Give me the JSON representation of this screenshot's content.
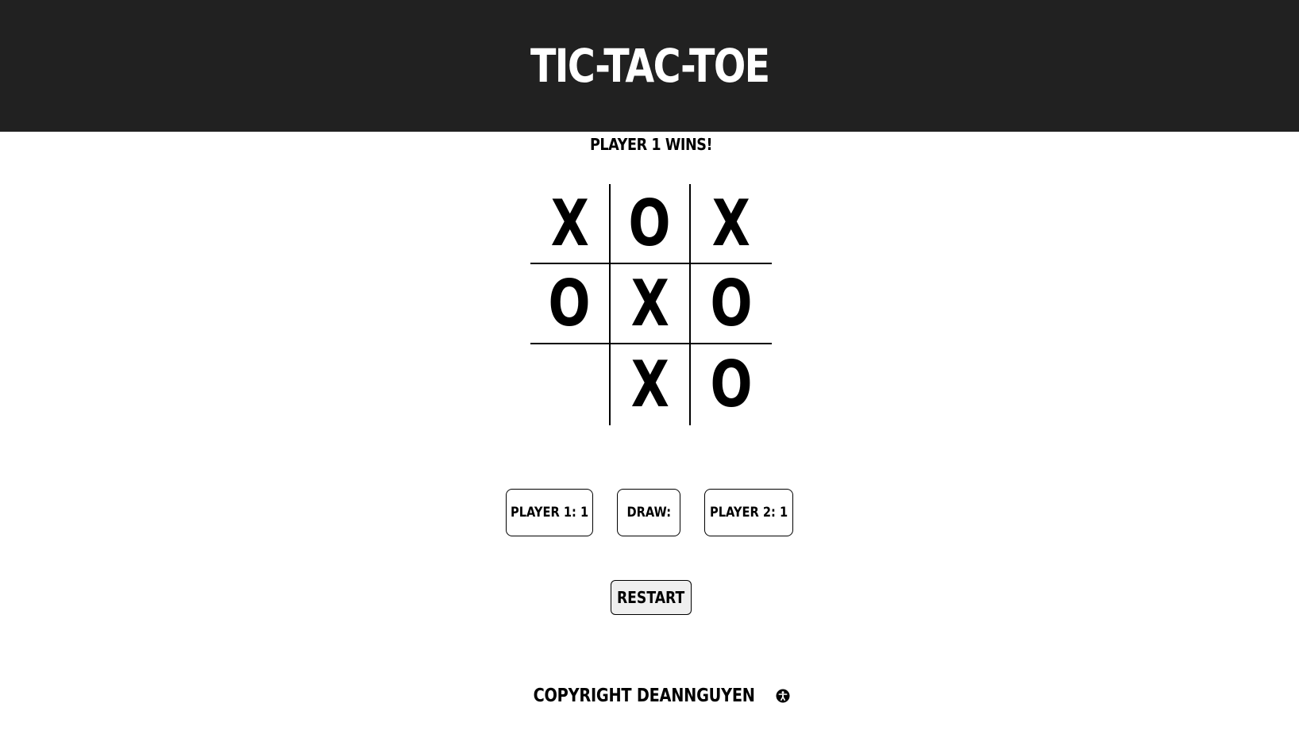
{
  "header": {
    "title": "TIC-TAC-TOE"
  },
  "status": {
    "message": "PLAYER 1 WINS!"
  },
  "board": {
    "cells": [
      "X",
      "O",
      "X",
      "O",
      "X",
      "O",
      "",
      "X",
      "O"
    ]
  },
  "scores": {
    "player1": "PLAYER 1: 1",
    "draw": "DRAW:",
    "player2": "PLAYER 2: 1"
  },
  "controls": {
    "restart_label": "RESTART"
  },
  "footer": {
    "copyright": "COPYRIGHT DEANNGUYEN",
    "icon": "accessibility-icon"
  },
  "colors": {
    "header_bg": "#212121",
    "header_text": "#ffffff",
    "button_bg": "#efefef"
  }
}
